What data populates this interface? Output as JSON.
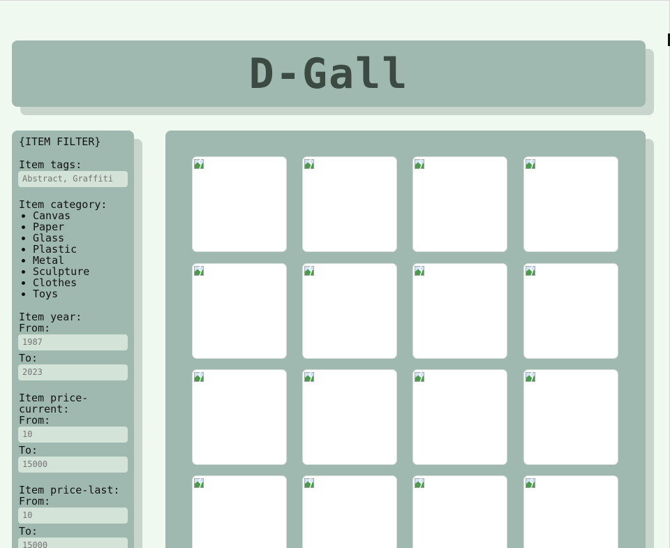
{
  "header": {
    "title": "D-Gall"
  },
  "sidebar": {
    "title": "{ITEM FILTER}",
    "tags": {
      "label": "Item tags:",
      "placeholder": "Abstract, Graffiti"
    },
    "category": {
      "label": "Item category:",
      "items": [
        "Canvas",
        "Paper",
        "Glass",
        "Plastic",
        "Metal",
        "Sculpture",
        "Clothes",
        "Toys"
      ]
    },
    "year": {
      "label": "Item year:",
      "from_label": "From:",
      "from_placeholder": "1987",
      "to_label": "To:",
      "to_placeholder": "2023"
    },
    "price_current": {
      "label": "Item price-current:",
      "from_label": "From:",
      "from_placeholder": "10",
      "to_label": "To:",
      "to_placeholder": "15000"
    },
    "price_last": {
      "label": "Item price-last:",
      "from_label": "From:",
      "from_placeholder": "10",
      "to_label": "To:",
      "to_placeholder": "15000"
    }
  },
  "gallery": {
    "rows": 4,
    "columns": 4,
    "tile_icon": "broken-image-icon"
  },
  "colors": {
    "page_background": "#f0f9f0",
    "panel": "#9fb9b0",
    "panel_shadow": "#c8d5cd",
    "input_background": "#d3e3d8",
    "title_text": "#3c4a44"
  }
}
